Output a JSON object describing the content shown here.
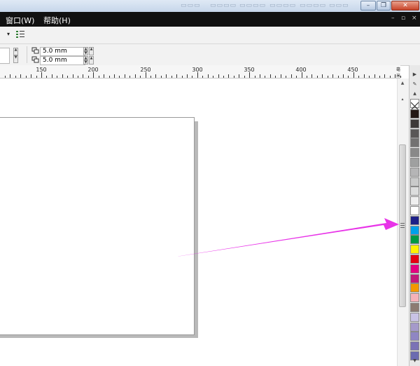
{
  "menu": {
    "window": "窗口(W)",
    "help": "帮助(H)"
  },
  "window_controls": {
    "minimize": "–",
    "restore": "❐",
    "close": "✕"
  },
  "doc_controls": {
    "minimize": "–",
    "restore": "▫",
    "close": "×"
  },
  "toolbar2": {
    "duplicate_x": "5.0 mm",
    "duplicate_y": "5.0 mm"
  },
  "ruler": {
    "labels": [
      "150",
      "200",
      "250",
      "300",
      "350",
      "400",
      "450"
    ],
    "unit": "毫米"
  },
  "palette": {
    "colors": [
      "#231815",
      "#3e3a39",
      "#595757",
      "#727171",
      "#898989",
      "#9fa0a0",
      "#b5b5b6",
      "#c9caca",
      "#dcdddd",
      "#efefef",
      "#ffffff",
      "#1d2088",
      "#00a0e9",
      "#009944",
      "#fff100",
      "#e60012",
      "#e4007f",
      "#c2187a",
      "#f39800",
      "#f6b2b9",
      "#8c7b72",
      "#c9c3e5",
      "#a59aca",
      "#8f86c3",
      "#7b72b5",
      "#6b6bb0"
    ]
  },
  "annotation": {
    "arrow_color": "#e833e8"
  }
}
